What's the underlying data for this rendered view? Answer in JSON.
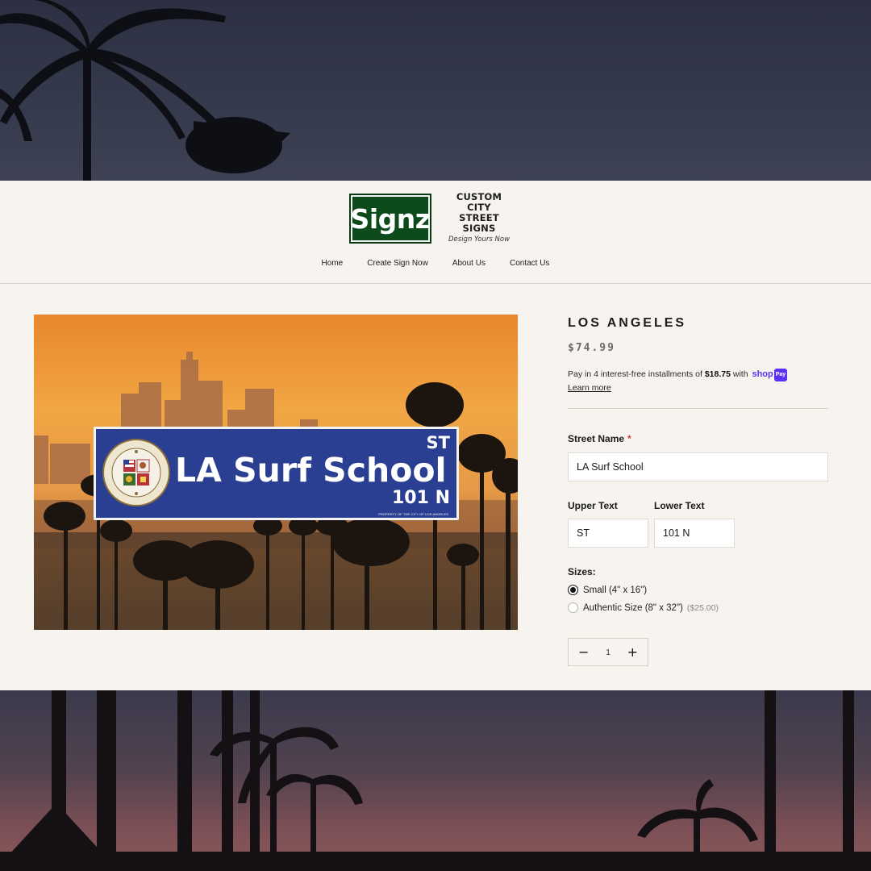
{
  "logo": {
    "brand": "Signz",
    "line1": "CUSTOM CITY",
    "line2": "STREET SIGNS",
    "line3": "Design Yours Now"
  },
  "nav": {
    "items": [
      "Home",
      "Create Sign Now",
      "About Us",
      "Contact Us"
    ]
  },
  "product": {
    "title": "LOS ANGELES",
    "price": "$74.99",
    "installments": {
      "prefix": "Pay in 4 interest-free installments of ",
      "amount": "$18.75",
      "suffix": " with ",
      "shop": "shop",
      "pay": "Pay",
      "learn_more": "Learn more"
    }
  },
  "sign": {
    "main_text": "LA Surf School",
    "upper_text": "ST",
    "lower_text": "101 N",
    "property_text": "PROPERTY OF THE CITY OF LOS ANGELES",
    "seal_text_top": "CITY OF LOS ANGELES",
    "seal_text_bottom": "FOUNDED 1781",
    "sign_color": "#2a3f92"
  },
  "form": {
    "street_name": {
      "label": "Street Name",
      "required_mark": "*",
      "value": "LA Surf School"
    },
    "upper_text": {
      "label": "Upper Text",
      "value": "ST"
    },
    "lower_text": {
      "label": "Lower Text",
      "value": "101 N"
    },
    "sizes": {
      "label": "Sizes:",
      "options": [
        {
          "label": "Small (4\" x 16\")",
          "price": "",
          "selected": true
        },
        {
          "label": "Authentic Size (8\" x 32\")",
          "price": "($25.00)",
          "selected": false
        }
      ]
    },
    "quantity": {
      "minus": "−",
      "value": "1",
      "plus": "+"
    }
  },
  "colors": {
    "panel": "#f7f4ef",
    "logo_green": "#0d4a1c",
    "shop_pay": "#5a31f4",
    "required": "#d9342b"
  }
}
